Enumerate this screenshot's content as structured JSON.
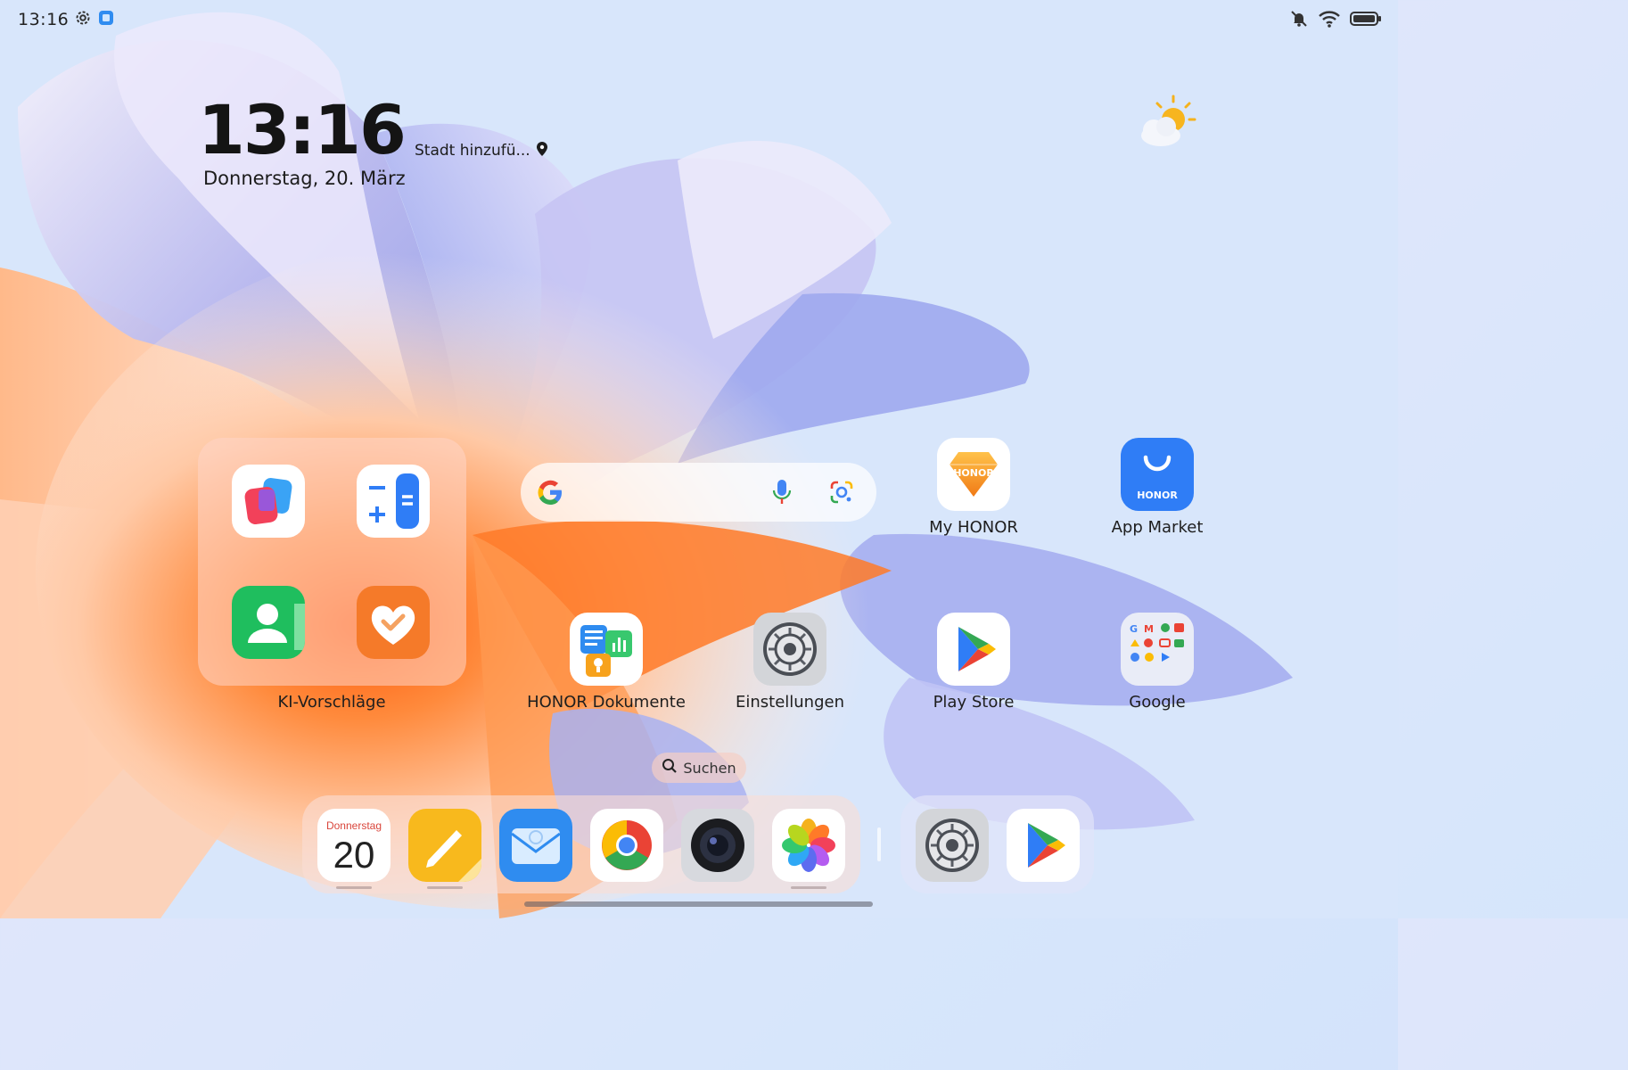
{
  "status_bar": {
    "time": "13:16",
    "left_icons": [
      "settings-gear-icon",
      "app-notification-icon"
    ],
    "right_icons": [
      "bell-muted-icon",
      "wifi-icon",
      "battery-icon"
    ]
  },
  "clock_widget": {
    "time": "13:16",
    "city": "Stadt hinzufü...",
    "date": "Donnerstag, 20. März"
  },
  "weather": {
    "icon": "partly-sunny-icon"
  },
  "folder": {
    "label": "KI-Vorschläge",
    "apps": [
      "multitask-app-icon",
      "calculator-app-icon",
      "contacts-app-icon",
      "health-app-icon"
    ]
  },
  "search_widget": {
    "icons": [
      "google-g-icon",
      "microphone-icon",
      "google-lens-icon"
    ]
  },
  "apps": {
    "my_honor": "My HONOR",
    "honor_brand": "HONOR",
    "app_market": "App Market",
    "honor_dokumente": "HONOR Dokumente",
    "einstellungen": "Einstellungen",
    "play_store": "Play Store",
    "google": "Google"
  },
  "suchen": {
    "label": "Suchen"
  },
  "dock": {
    "calendar_weekday": "Donnerstag",
    "calendar_day": "20",
    "apps": [
      "calendar",
      "notes",
      "email",
      "chrome",
      "camera",
      "gallery"
    ],
    "recent": [
      "settings",
      "play-store"
    ]
  },
  "colors": {
    "accent_blue": "#2f7df6",
    "honor_orange": "#f59a3b",
    "calendar_red": "#d9453b"
  }
}
